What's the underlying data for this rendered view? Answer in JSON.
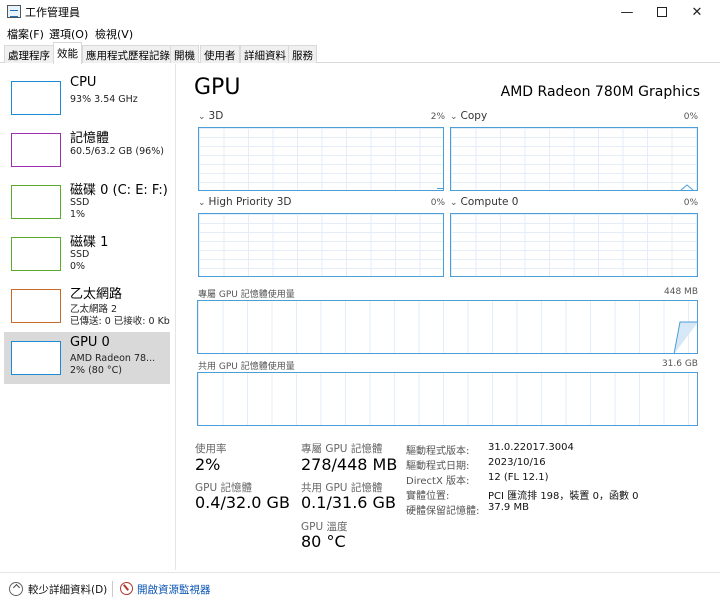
{
  "window": {
    "title": "工作管理員",
    "minimize": "—",
    "close": "✕"
  },
  "menu": [
    "檔案(F)",
    "選項(O)",
    "檢視(V)"
  ],
  "tabs": [
    "處理程序",
    "效能",
    "應用程式歷程記錄",
    "開機",
    "使用者",
    "詳細資料",
    "服務"
  ],
  "active_tab": "效能",
  "sidebar": [
    {
      "title": "CPU",
      "line1": "93%  3.54 GHz",
      "line2": "",
      "thumb_color": "#1e8ad6"
    },
    {
      "title": "記憶體",
      "line1": "60.5/63.2 GB (96%)",
      "line2": "",
      "thumb_color": "#9b2fae"
    },
    {
      "title": "磁碟 0 (C: E: F:)",
      "line1": "SSD",
      "line2": "1%",
      "thumb_color": "#5aab2d"
    },
    {
      "title": "磁碟 1",
      "line1": "SSD",
      "line2": "0%",
      "thumb_color": "#5aab2d"
    },
    {
      "title": "乙太網路",
      "line1": "乙太網路 2",
      "line2": "已傳送: 0 已接收: 0 Kbps",
      "thumb_color": "#c66a2a"
    },
    {
      "title": "GPU 0",
      "line1": "AMD Radeon 78...",
      "line2": "2% (80 °C)",
      "thumb_color": "#1e8ad6"
    }
  ],
  "main": {
    "title": "GPU",
    "gpu_name": "AMD Radeon 780M Graphics",
    "graphs": [
      {
        "label": "3D",
        "value": "2%",
        "fill": 0.02
      },
      {
        "label": "Copy",
        "value": "0%",
        "fill": 0.0
      },
      {
        "label": "High Priority 3D",
        "value": "0%",
        "fill": 0.0
      },
      {
        "label": "Compute 0",
        "value": "0%",
        "fill": 0.0
      }
    ],
    "dedicated_mem": {
      "label": "專屬 GPU 記憶體使用量",
      "max": "448 MB"
    },
    "shared_mem": {
      "label": "共用 GPU 記憶體使用量",
      "max": "31.6 GB"
    },
    "stats": {
      "utilization_label": "使用率",
      "utilization_value": "2%",
      "dedicated_label": "專屬 GPU 記憶體",
      "dedicated_value": "278/448 MB",
      "gpu_mem_label": "GPU 記憶體",
      "gpu_mem_value": "0.4/32.0 GB",
      "shared_label": "共用 GPU 記憶體",
      "shared_value": "0.1/31.6 GB",
      "temp_label": "GPU 溫度",
      "temp_value": "80 °C"
    },
    "info": [
      {
        "label": "驅動程式版本:",
        "value": "31.0.22017.3004"
      },
      {
        "label": "驅動程式日期:",
        "value": "2023/10/16"
      },
      {
        "label": "DirectX 版本:",
        "value": "12 (FL 12.1)"
      },
      {
        "label": "實體位置:",
        "value": "PCI 匯流排 198，裝置 0，函數 0"
      },
      {
        "label": "硬體保留記憶體:",
        "value": "37.9 MB"
      }
    ]
  },
  "bottom": {
    "fewer_details": "較少詳細資料(D)",
    "open_monitor": "開啟資源監視器"
  }
}
